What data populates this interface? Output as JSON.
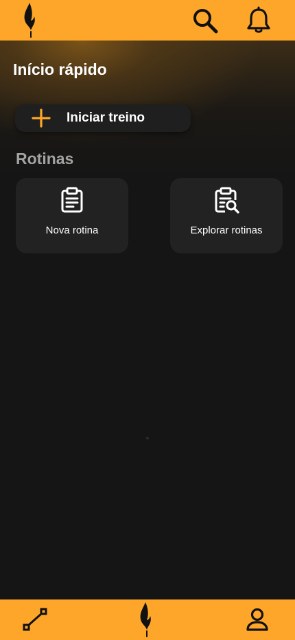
{
  "header": {
    "logo_icon": "flame-logo-icon",
    "actions": [
      {
        "icon": "search-icon"
      },
      {
        "icon": "bell-icon"
      }
    ]
  },
  "quick_start": {
    "title": "Início rápido",
    "start_button": {
      "icon": "plus-icon",
      "label": "Iniciar treino"
    }
  },
  "routines": {
    "title": "Rotinas",
    "cards": [
      {
        "icon": "clipboard-icon",
        "label": "Nova rotina"
      },
      {
        "icon": "clipboard-search-icon",
        "label": "Explorar rotinas"
      }
    ]
  },
  "bottom_nav": {
    "items": [
      {
        "icon": "route-icon"
      },
      {
        "icon": "flame-logo-icon"
      },
      {
        "icon": "profile-icon"
      }
    ]
  },
  "colors": {
    "accent": "#fea629",
    "background": "#151515",
    "card": "#222222",
    "button": "#1f1f1f",
    "text": "#ffffff",
    "muted_text": "#a4a4a4"
  }
}
